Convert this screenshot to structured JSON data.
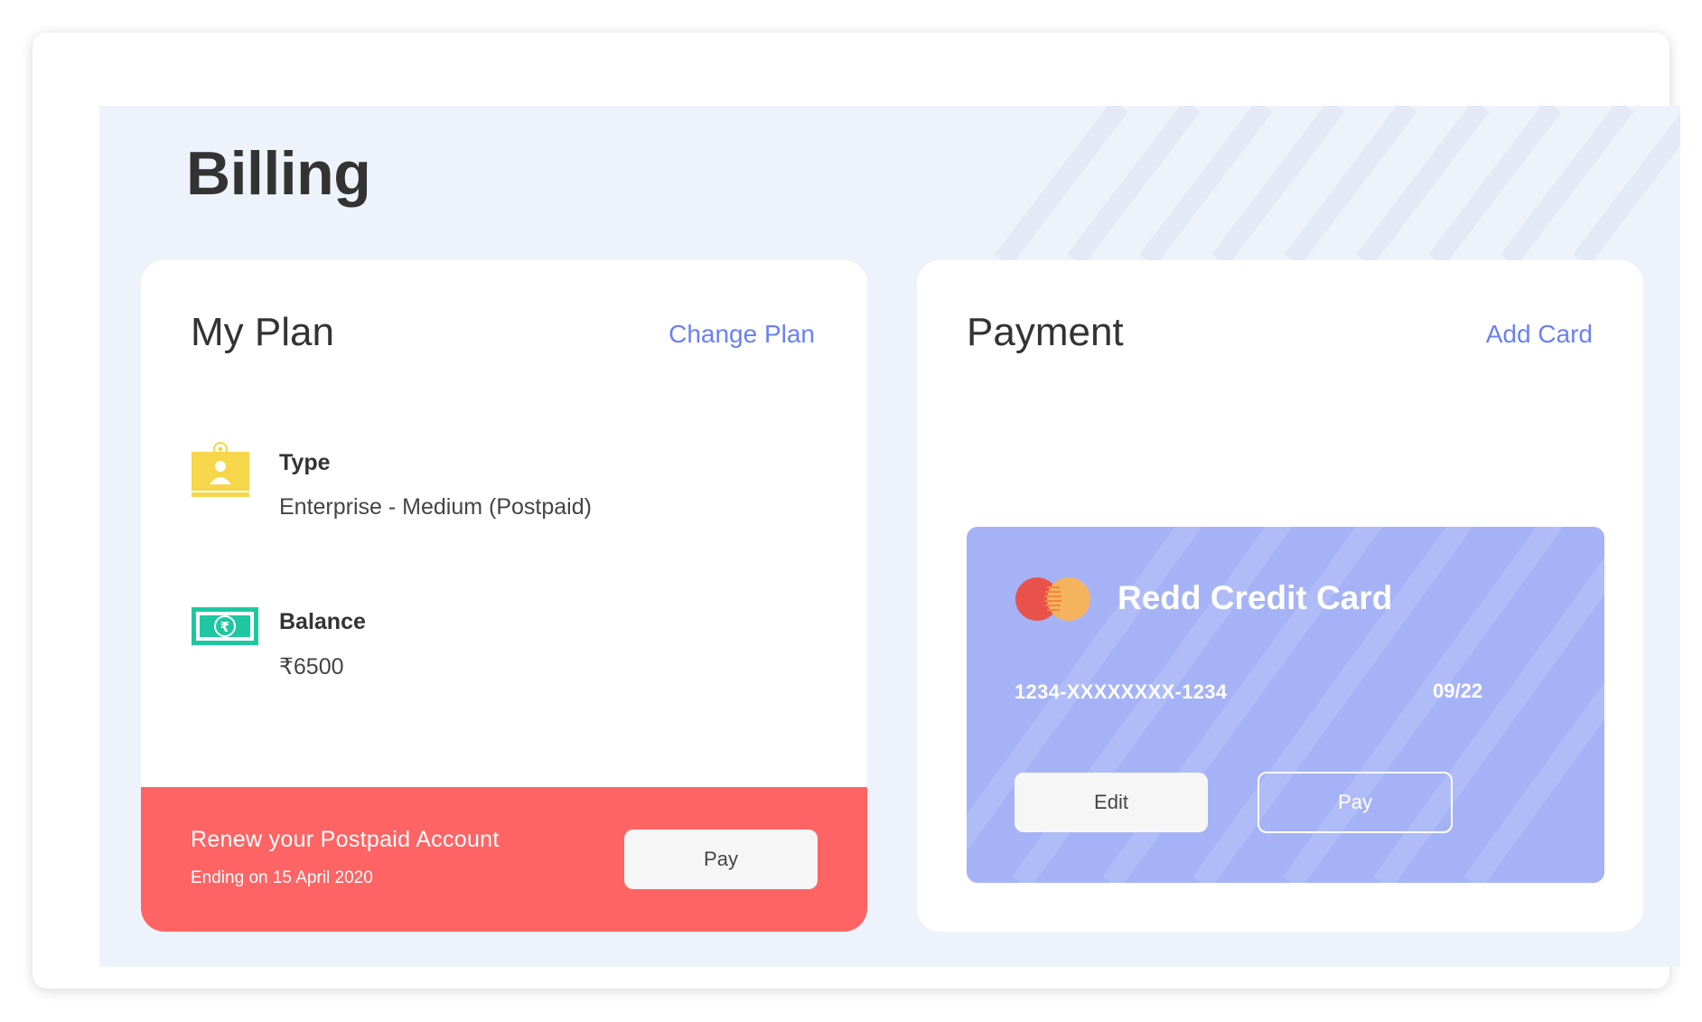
{
  "page": {
    "title": "Billing"
  },
  "plan": {
    "title": "My Plan",
    "change_link": "Change Plan",
    "type": {
      "icon": "id-badge-icon",
      "label": "Type",
      "value": "Enterprise - Medium (Postpaid)"
    },
    "balance": {
      "icon": "rupee-banknote-icon",
      "label": "Balance",
      "value": "₹6500"
    },
    "renew": {
      "title": "Renew your Postpaid Account",
      "subtitle": "Ending on 15 April 2020",
      "pay_label": "Pay"
    }
  },
  "payment": {
    "title": "Payment",
    "add_link": "Add Card",
    "card": {
      "logo": "mastercard-logo-icon",
      "name": "Redd Credit Card",
      "number": "1234-XXXXXXXX-1234",
      "expiry": "09/22",
      "edit_label": "Edit",
      "pay_label": "Pay"
    }
  },
  "colors": {
    "accent": "#6b80f4",
    "panel_background": "#eef3fb",
    "renew_bar": "#ff6464",
    "credit_card": "#a5b3f6",
    "icon_yellow": "#f6d64a",
    "icon_green": "#1ec7a1"
  }
}
